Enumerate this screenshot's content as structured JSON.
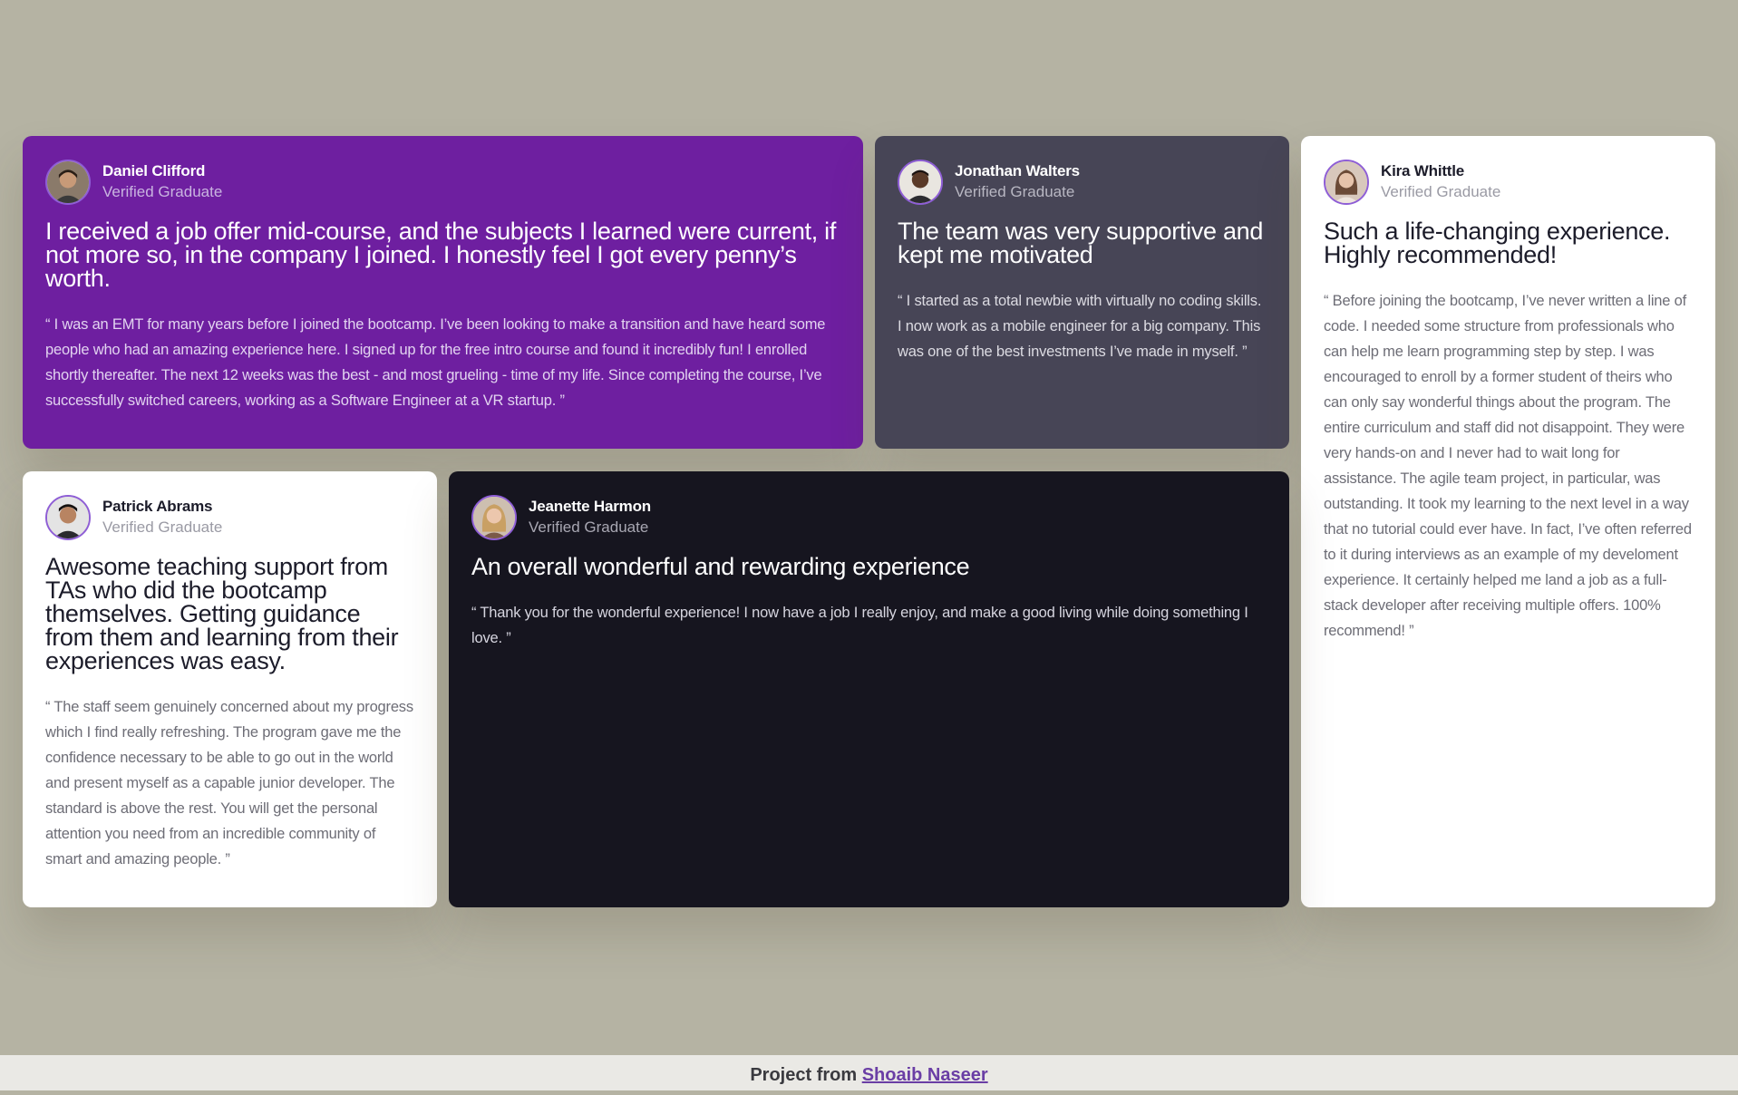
{
  "testimonials": [
    {
      "name": "Daniel Clifford",
      "role": "Verified Graduate",
      "title": "I received a job offer mid-course, and the subjects I learned were current, if not more so, in the company I joined. I honestly feel I got every penny’s worth.",
      "quote": "“ I was an EMT for many years before I joined the bootcamp. I’ve been looking to make a transition and have heard some people who had an amazing experience here. I signed up for the free intro course and found it incredibly fun! I enrolled shortly thereafter. The next 12 weeks was the best - and most grueling - time of my life. Since completing the course, I’ve successfully switched careers, working as a Software Engineer at a VR startup. ”"
    },
    {
      "name": "Jonathan Walters",
      "role": "Verified Graduate",
      "title": "The team was very supportive and kept me motivated",
      "quote": "“ I started as a total newbie with virtually no coding skills. I now work as a mobile engineer for a big company. This was one of the best investments I’ve made in myself. ”"
    },
    {
      "name": "Kira Whittle",
      "role": "Verified Graduate",
      "title": "Such a life-changing experience. Highly recommended!",
      "quote": "“ Before joining the bootcamp, I’ve never written a line of code. I needed some structure from professionals who can help me learn programming step by step. I was encouraged to enroll by a former student of theirs who can only say wonderful things about the program. The entire curriculum and staff did not disappoint. They were very hands-on and I never had to wait long for assistance. The agile team project, in particular, was outstanding. It took my learning to the next level in a way that no tutorial could ever have. In fact, I’ve often referred to it during interviews as an example of my develoment experience. It certainly helped me land a job as a full-stack developer after receiving multiple offers. 100% recommend! ”"
    },
    {
      "name": "Patrick Abrams",
      "role": "Verified Graduate",
      "title": "Awesome teaching support from TAs who did the bootcamp themselves. Getting guidance from them and learning from their experiences was easy.",
      "quote": "“ The staff seem genuinely concerned about my progress which I find really refreshing. The program gave me the confidence necessary to be able to go out in the world and present myself as a capable junior developer. The standard is above the rest. You will get the personal attention you need from an incredible community of smart and amazing people. ”"
    },
    {
      "name": "Jeanette Harmon",
      "role": "Verified Graduate",
      "title": "An overall wonderful and rewarding experience",
      "quote": "“ Thank you for the wonderful experience! I now have a job I really enjoy, and make a good living while doing something I love. ”"
    }
  ],
  "footer": {
    "prefix": "Project from",
    "author": "Shoaib Naseer"
  },
  "colors": {
    "background": "#b5b3a3",
    "purple": "#6e1fa0",
    "gray_blue": "#474556",
    "dark": "#16151f",
    "white": "#ffffff",
    "avatar_border": "#8e5ed6"
  }
}
